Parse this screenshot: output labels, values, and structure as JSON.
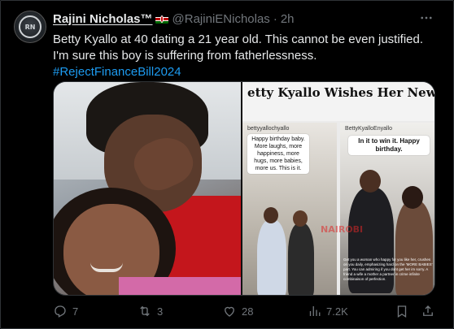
{
  "tweet": {
    "author_name": "Rajini Nicholas™",
    "handle": "@RajiniENicholas",
    "separator": "·",
    "time": "2h",
    "more_icon": "more-horizontal-icon",
    "text_line": "Betty Kyallo at 40 dating a 21 year old. This cannot be even justified. I'm sure this boy is suffering from fatherlessness.",
    "hashtag": "#RejectFinanceBill2024",
    "flag": "kenya-flag-icon",
    "colors": {
      "link": "#1d9bf0",
      "muted": "#71767b",
      "text": "#e7e9ea",
      "background": "#000000"
    }
  },
  "media": {
    "right_title": "etty Kyallo Wishes Her New Youn Boyfriend A Happy Birthday",
    "heart": "❤",
    "panel_one": {
      "handle": "bettyyallochyallo",
      "bubble": "Happy birthday baby. More laughs, more happiness, more hugs, more babies, more us. This is it."
    },
    "panel_two": {
      "handle": "BettyKyalloEnyallo",
      "bubble": "In it to win it. Happy birthday."
    },
    "watermark": "NAIROBI",
    "caption": "Get you a woman who happy for you like her, crushes on you daily, emphasizing hard on the 'MORE BABIES' part. You can admiring if you dont get her im sorry. A friend a wife a mother a partner in crime infinite combinaison of perfection."
  },
  "actions": {
    "reply_count": "7",
    "retweet_count": "3",
    "like_count": "28",
    "views_count": "7.2K"
  }
}
